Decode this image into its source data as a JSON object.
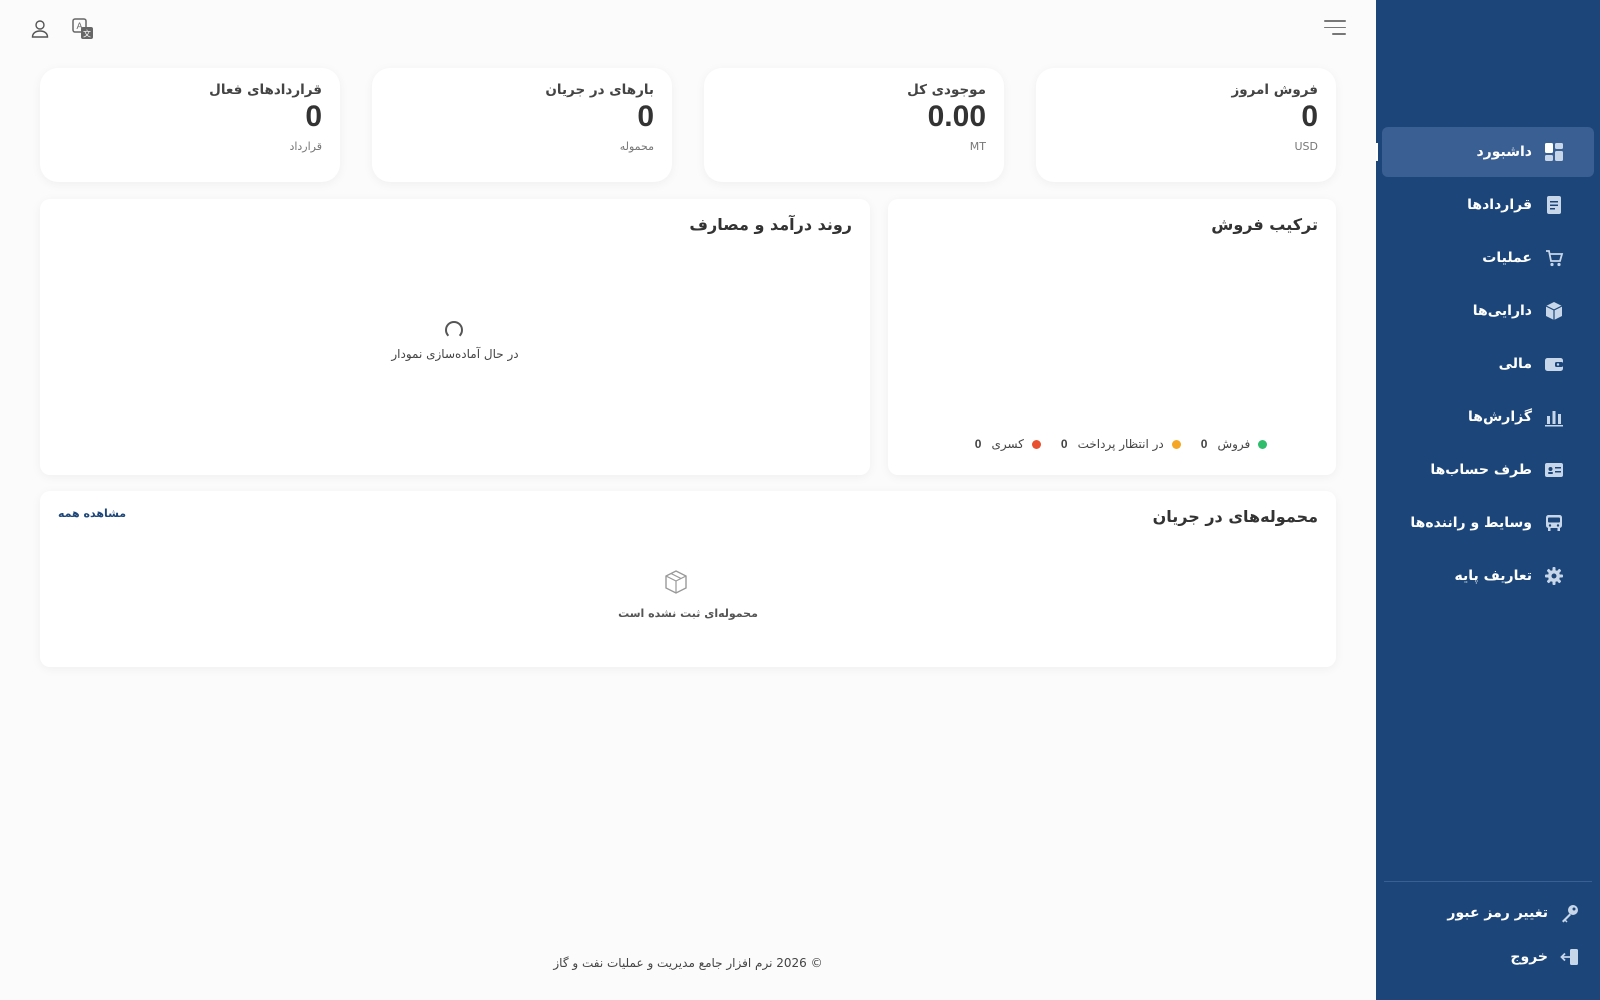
{
  "sidebar": {
    "items": [
      {
        "label": "داشبورد",
        "icon": "dashboard-icon",
        "active": true
      },
      {
        "label": "قراردادها",
        "icon": "document-icon"
      },
      {
        "label": "عملیات",
        "icon": "cart-icon"
      },
      {
        "label": "دارایی‌ها",
        "icon": "box-icon"
      },
      {
        "label": "مالی",
        "icon": "wallet-icon"
      },
      {
        "label": "گزارش‌ها",
        "icon": "bar-chart-icon"
      },
      {
        "label": "طرف حساب‌ها",
        "icon": "id-card-icon"
      },
      {
        "label": "وسایط و راننده‌ها",
        "icon": "bus-icon"
      },
      {
        "label": "تعاریف پایه",
        "icon": "gear-icon"
      }
    ],
    "change_password": "تغییر رمز عبور",
    "logout": "خروج"
  },
  "stats": [
    {
      "title": "فروش امروز",
      "value": "0",
      "unit": "USD"
    },
    {
      "title": "موجودی کل",
      "value": "0.00",
      "unit": "MT"
    },
    {
      "title": "بارهای در جریان",
      "value": "0",
      "unit": "محموله"
    },
    {
      "title": "قراردادهای فعال",
      "value": "0",
      "unit": "قرارداد"
    }
  ],
  "sales_mix": {
    "title": "ترکیب فروش",
    "legend": [
      {
        "label": "فروش",
        "value": "0",
        "color": "#2ebd6b"
      },
      {
        "label": "در انتظار پرداخت",
        "value": "0",
        "color": "#f5a623"
      },
      {
        "label": "کسری",
        "value": "0",
        "color": "#e8502f"
      }
    ]
  },
  "trend": {
    "title": "روند درآمد و مصارف",
    "loading": "در حال آماده‌سازی نمودار"
  },
  "shipments": {
    "title": "محموله‌های در جریان",
    "view_all": "مشاهده همه",
    "empty": "محموله‌ای ثبت نشده است"
  },
  "footer": "© 2026 نرم افزار جامع مدیریت و عملیات نفت و گاز",
  "colors": {
    "sidebar": "#1c4679",
    "active": "#3a5f92"
  }
}
